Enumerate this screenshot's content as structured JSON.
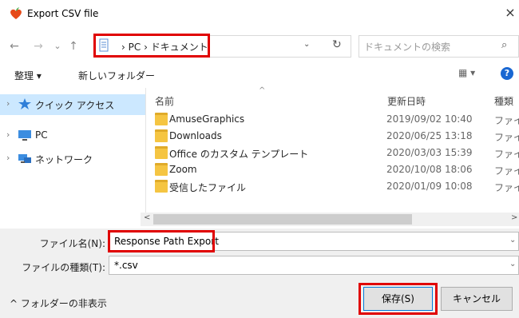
{
  "window": {
    "title": "Export CSV file",
    "close_glyph": "×"
  },
  "nav": {
    "back_glyph": "←",
    "forward_glyph": "→",
    "recent_glyph": "⌄",
    "up_glyph": "↑",
    "address_separator": "›",
    "address": [
      "PC",
      "ドキュメント"
    ],
    "address_dropdown_glyph": "⌄",
    "refresh_glyph": "↻",
    "search_placeholder": "ドキュメントの検索",
    "search_glyph": "⌕"
  },
  "commandbar": {
    "organize": "整理 ▾",
    "new_folder": "新しいフォルダー",
    "view_glyph": "▦ ▾",
    "help_glyph": "?"
  },
  "sidebar": {
    "chevron_glyph": "›",
    "items": [
      {
        "label": "クイック アクセス",
        "icon": "star-icon",
        "selected": true
      },
      {
        "label": "PC",
        "icon": "pc-icon",
        "selected": false
      },
      {
        "label": "ネットワーク",
        "icon": "network-icon",
        "selected": false
      }
    ]
  },
  "table": {
    "sort_glyph": "^",
    "columns": [
      "名前",
      "更新日時",
      "種類"
    ],
    "rows": [
      {
        "name": "AmuseGraphics",
        "date": "2019/09/02 10:40",
        "type": "ファイル"
      },
      {
        "name": "Downloads",
        "date": "2020/06/25 13:18",
        "type": "ファイル"
      },
      {
        "name": "Office のカスタム テンプレート",
        "date": "2020/03/03 15:39",
        "type": "ファイル"
      },
      {
        "name": "Zoom",
        "date": "2020/10/08 18:06",
        "type": "ファイル"
      },
      {
        "name": "受信したファイル",
        "date": "2020/01/09 10:08",
        "type": "ファイル"
      }
    ]
  },
  "scrollbar": {
    "left_glyph": "<",
    "right_glyph": ">"
  },
  "form": {
    "filename_label": "ファイル名(N):",
    "filename_value": "Response Path Export",
    "filetype_label": "ファイルの種類(T):",
    "filetype_value": "*.csv",
    "dropdown_glyph": "⌄"
  },
  "footer": {
    "toggle_label": "^ フォルダーの非表示",
    "save_label": "保存(S)",
    "cancel_label": "キャンセル"
  },
  "colors": {
    "highlight": "#e00000",
    "accent": "#0078d7",
    "selected_bg": "#cce8ff",
    "folder": "#f5c542"
  }
}
